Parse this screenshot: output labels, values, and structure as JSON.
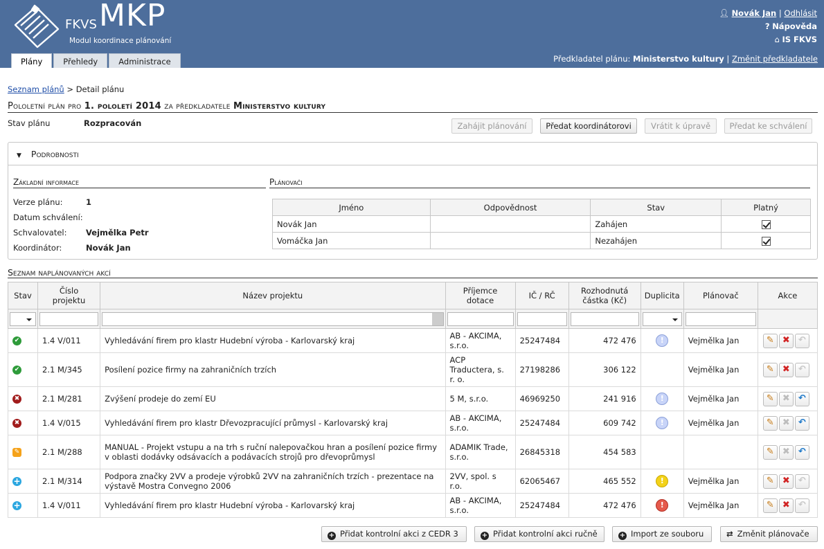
{
  "header": {
    "logo_fkvs": "FKVS",
    "logo_mkp": "MKP",
    "logo_subtitle": "Modul koordinace plánování",
    "user_name": "Novák Jan",
    "logout": "Odhlásit",
    "help": "Nápověda",
    "is_link": "IS FKVS",
    "tabs": [
      "Plány",
      "Přehledy",
      "Administrace"
    ],
    "submitter_label": "Předkladatel plánu:",
    "submitter_value": "Ministerstvo kultury",
    "change_submitter": "Změnit předkladatele"
  },
  "breadcrumb": {
    "link": "Seznam plánů",
    "sep": ">",
    "current": "Detail plánu"
  },
  "title": {
    "prefix": "Pololetní plán pro",
    "period": "1. pololetí 2014",
    "middle": "za předkladatele",
    "submitter": "Ministerstvo kultury"
  },
  "status": {
    "label": "Stav plánu",
    "value": "Rozpracován"
  },
  "buttons": {
    "start": "Zahájit plánování",
    "to_coordinator": "Předat koordinátorovi",
    "return": "Vrátit k úpravě",
    "to_approval": "Předat ke schválení"
  },
  "details": {
    "heading": "Podrobnosti",
    "info_title": "Základní informace",
    "planners_title": "Plánovači",
    "info": [
      {
        "label": "Verze plánu:",
        "value": "1"
      },
      {
        "label": "Datum schválení:",
        "value": ""
      },
      {
        "label": "Schvalovatel:",
        "value": "Vejmělka Petr"
      },
      {
        "label": "Koordinátor:",
        "value": "Novák Jan"
      }
    ],
    "planners_headers": [
      "Jméno",
      "Odpovědnost",
      "Stav",
      "Platný"
    ],
    "planners": [
      {
        "name": "Novák Jan",
        "responsibility": "",
        "state": "Zahájen",
        "valid": true
      },
      {
        "name": "Vomáčka Jan",
        "responsibility": "",
        "state": "Nezahájen",
        "valid": true
      }
    ]
  },
  "actions": {
    "title": "Seznam naplánovaných akcí",
    "headers": [
      "Stav",
      "Číslo projektu",
      "Název projektu",
      "Příjemce dotace",
      "IČ / RČ",
      "Rozhodnutá částka (Kč)",
      "Duplicita",
      "Plánovač",
      "Akce"
    ],
    "rows": [
      {
        "status": "ok",
        "number": "1.4 V/011",
        "name": "Vyhledávání firem pro klastr Hudební výroba - Karlovarský kraj",
        "recipient": "AB - AKCIMA, s.r.o.",
        "ic": "25247484",
        "amount": "472 476",
        "dup": "info",
        "planner": "Vejmělka Jan",
        "del": true,
        "undo": false
      },
      {
        "status": "ok",
        "number": "2.1 M/345",
        "name": "Posílení pozice firmy na zahraničních trzích",
        "recipient": "ACP Traductera, s. r. o.",
        "ic": "27198286",
        "amount": "306 122",
        "dup": "",
        "planner": "Vejmělka Jan",
        "del": true,
        "undo": false
      },
      {
        "status": "x",
        "number": "2.1 M/281",
        "name": "Zvýšení prodeje do zemí EU",
        "recipient": "5 M, s.r.o.",
        "ic": "46969250",
        "amount": "241 916",
        "dup": "info",
        "planner": "Vejmělka Jan",
        "del": false,
        "undo": true
      },
      {
        "status": "x",
        "number": "1.4 V/015",
        "name": "Vyhledávání firem pro klastr Dřevozpracující průmysl - Karlovarský kraj",
        "recipient": "AB - AKCIMA, s.r.o.",
        "ic": "25247484",
        "amount": "609 742",
        "dup": "info",
        "planner": "Vejmělka Jan",
        "del": false,
        "undo": true
      },
      {
        "status": "edit",
        "number": "2.1 M/288",
        "name": "MANUAL - Projekt vstupu a na trh s ruční nalepovačkou hran a posílení pozice firmy v oblasti dodávky odsávacích a podávacích strojů pro dřevoprůmysl",
        "recipient": "ADAMIK Trade, s.r.o.",
        "ic": "26845318",
        "amount": "454 583",
        "dup": "",
        "planner": "",
        "del": false,
        "undo": true
      },
      {
        "status": "plus",
        "number": "2.1 M/314",
        "name": "Podpora značky 2VV a prodeje výrobků 2VV na zahraničních trzích - prezentace na výstavě Mostra Convegno 2006",
        "recipient": "2VV, spol. s r.o.",
        "ic": "62065467",
        "amount": "465 552",
        "dup": "warn",
        "planner": "Vejmělka Jan",
        "del": true,
        "undo": false
      },
      {
        "status": "plus",
        "number": "1.4 V/011",
        "name": "Vyhledávání firem pro klastr Hudební výroba - Karlovarský kraj",
        "recipient": "AB - AKCIMA, s.r.o.",
        "ic": "25247484",
        "amount": "472 476",
        "dup": "err",
        "planner": "Vejmělka Jan",
        "del": true,
        "undo": false
      }
    ]
  },
  "bottom_buttons": {
    "add_cedr": "Přidat kontrolní akci z CEDR 3",
    "add_manual": "Přidat kontrolní akci ručně",
    "import": "Import ze souboru",
    "change_planners": "Změnit plánovače"
  }
}
